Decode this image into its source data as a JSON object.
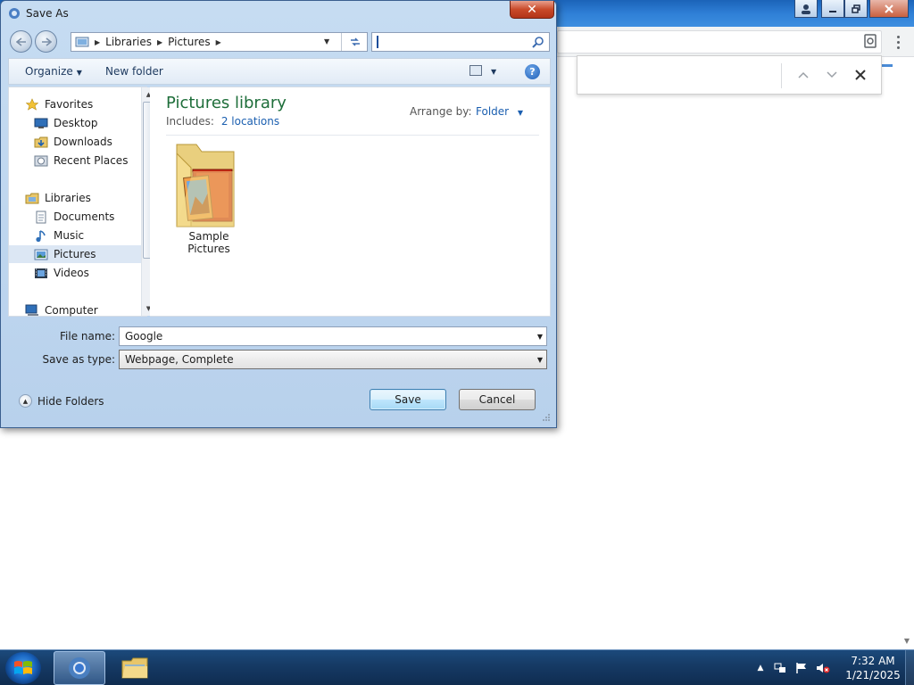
{
  "dialog": {
    "title": "Save As",
    "close_symbol": "✕",
    "address": {
      "crumbs": [
        "Libraries",
        "Pictures"
      ]
    },
    "search": {
      "value": "",
      "placeholder": ""
    },
    "commandbar": {
      "organize": "Organize",
      "new_folder": "New folder"
    },
    "navpane": {
      "items": [
        {
          "label": "Favorites",
          "icon": "star-icon"
        },
        {
          "label": "Desktop",
          "icon": "desktop-icon"
        },
        {
          "label": "Downloads",
          "icon": "downloads-icon"
        },
        {
          "label": "Recent Places",
          "icon": "recent-places-icon"
        },
        {
          "label": "Libraries",
          "icon": "libraries-icon"
        },
        {
          "label": "Documents",
          "icon": "documents-icon"
        },
        {
          "label": "Music",
          "icon": "music-icon"
        },
        {
          "label": "Pictures",
          "icon": "pictures-icon",
          "selected": true
        },
        {
          "label": "Videos",
          "icon": "videos-icon"
        },
        {
          "label": "Computer",
          "icon": "computer-icon"
        }
      ]
    },
    "content": {
      "library_title": "Pictures library",
      "includes_label": "Includes:",
      "includes_link": "2 locations",
      "arrange_label": "Arrange by:",
      "arrange_value": "Folder",
      "items": [
        {
          "label": "Sample Pictures",
          "icon": "folder-pictures-icon"
        }
      ]
    },
    "form": {
      "filename_label": "File name:",
      "filename_value": "Google",
      "type_label": "Save as type:",
      "type_value": "Webpage, Complete"
    },
    "hide_folders": "Hide Folders",
    "save": "Save",
    "cancel": "Cancel"
  },
  "taskbar": {
    "time": "7:32 AM",
    "date": "1/21/2025"
  },
  "colors": {
    "library_title": "#1e6e3a",
    "link": "#1b5fb0",
    "taskbar": "#163b66"
  }
}
